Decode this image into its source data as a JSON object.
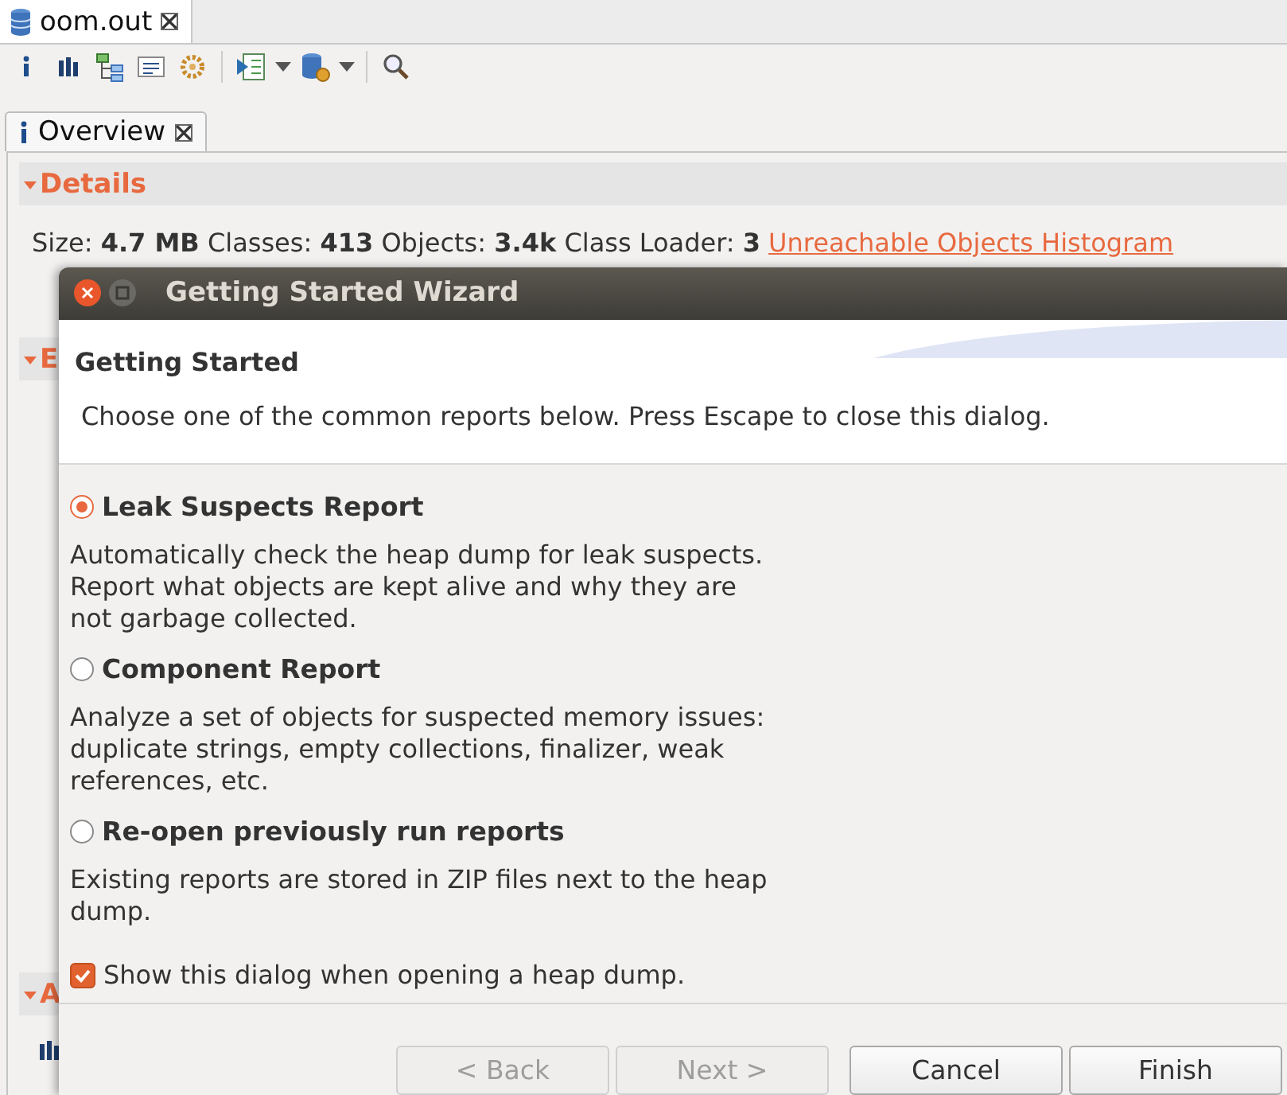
{
  "editor_tab": {
    "label": "oom.out"
  },
  "view_tab": {
    "label": "Overview"
  },
  "sections": [
    {
      "title": "Details",
      "expanded": true
    },
    {
      "title": "E",
      "expanded": true
    },
    {
      "title": "A",
      "expanded": true
    }
  ],
  "details": {
    "summary": "Size: **4.7 MB** Classes: **413** Objects: **3.4k** Class Loader: **3**",
    "link": "Unreachable Objects Histogram"
  },
  "dialog": {
    "title": "Getting Started Wizard",
    "heading": "Getting Started",
    "description": "Choose one of the common reports below. Press Escape to close this dialog.",
    "options": [
      {
        "label": "Leak Suspects Report",
        "description": "Automatically check the heap dump for leak suspects. Report what objects are kept alive and why they are not garbage collected.",
        "selected": true
      },
      {
        "label": "Component Report",
        "description": "Analyze a set of objects for suspected memory issues: duplicate strings, empty collections, finalizer, weak references, etc.",
        "selected": false
      },
      {
        "label": "Re-open previously run reports",
        "description": "Existing reports are stored in ZIP files next to the heap dump.",
        "selected": false
      }
    ],
    "show_on_open": {
      "label": "Show this dialog when opening a heap dump.",
      "checked": true
    },
    "buttons": [
      {
        "label": "< Back",
        "disabled": true
      },
      {
        "label": "Next >",
        "disabled": true
      },
      {
        "label": "Cancel",
        "disabled": false
      },
      {
        "label": "Finish",
        "disabled": false
      }
    ]
  }
}
